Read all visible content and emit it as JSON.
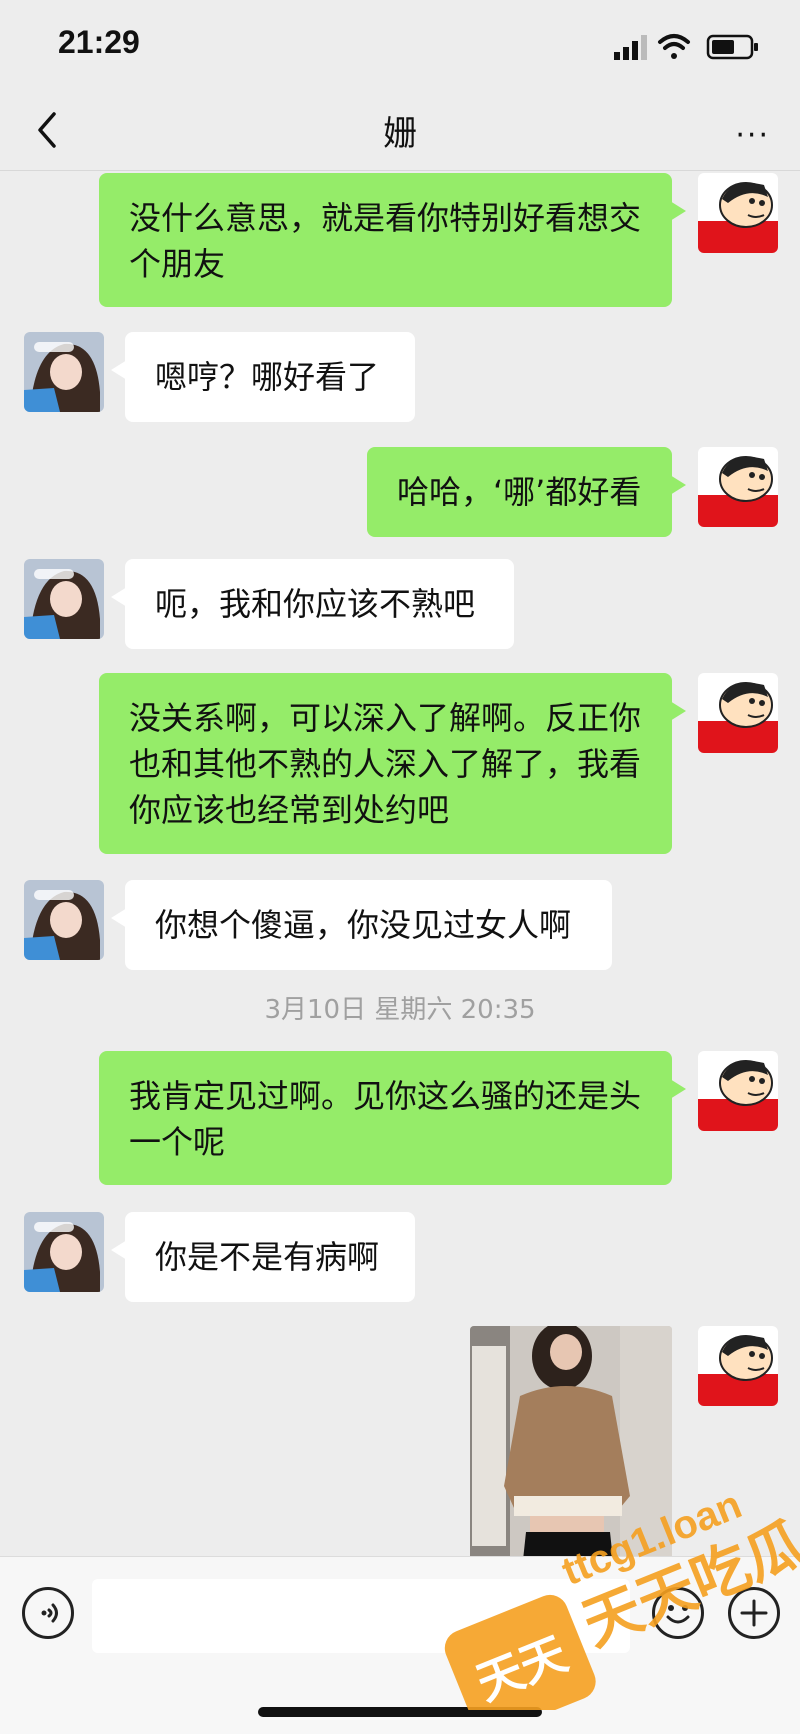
{
  "status_bar": {
    "time": "21:29"
  },
  "header": {
    "title": "姗",
    "more": "···"
  },
  "messages": [
    {
      "side": "me",
      "text": "没什么意思，就是看你特别好看想交个朋友"
    },
    {
      "side": "them",
      "text": "嗯哼？哪好看了"
    },
    {
      "side": "me",
      "text": "哈哈，‘哪’都好看"
    },
    {
      "side": "them",
      "text": "呃，我和你应该不熟吧"
    },
    {
      "side": "me",
      "text": "没关系啊，可以深入了解啊。反正你也和其他不熟的人深入了解了，我看你应该也经常到处约吧"
    },
    {
      "side": "them",
      "text": "你想个傻逼，你没见过女人啊"
    },
    {
      "side": "me",
      "text": "我肯定见过啊。见你这么骚的还是头一个呢"
    },
    {
      "side": "them",
      "text": "你是不是有病啊"
    }
  ],
  "timestamp": "3月10日 星期六 20:35",
  "watermark": {
    "url": "ttcg1.loan",
    "label": "天天吃瓜",
    "logo": "天天"
  },
  "colors": {
    "my_bubble": "#95ec69",
    "their_bubble": "#ffffff",
    "background": "#ededed",
    "watermark": "#f5a020"
  }
}
